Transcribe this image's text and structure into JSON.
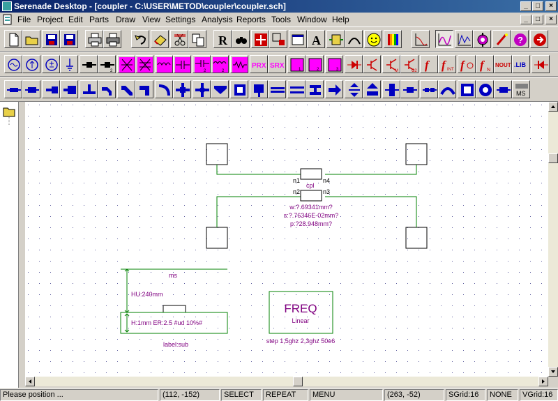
{
  "window": {
    "title": "Serenade Desktop - [coupler - C:\\USER\\METOD\\coupler\\coupler.sch]",
    "controls": [
      "_",
      "□",
      "×"
    ],
    "inner_controls": [
      "_",
      "□",
      "×"
    ]
  },
  "menu": [
    "File",
    "Project",
    "Edit",
    "Parts",
    "Draw",
    "View",
    "Settings",
    "Analysis",
    "Reports",
    "Tools",
    "Window",
    "Help"
  ],
  "toolbar1": {
    "text_buttons": {
      "resistor": "R",
      "text": "A"
    }
  },
  "toolbar2": {
    "labels": {
      "prx": "PRX",
      "srx": "SRX",
      "nout": "NOUT",
      "lib": ".LIB"
    }
  },
  "toolbar3": {
    "labels": {
      "ms": "MS"
    }
  },
  "schematic": {
    "coupler": {
      "name": "cpl",
      "ports": [
        "n1",
        "n4",
        "n2",
        "n3"
      ],
      "params": [
        "w:?.69341mm?",
        "s:?.76346E-02mm?",
        "p:?28.948mm?"
      ]
    },
    "substrate": {
      "name": "ms",
      "height_label": "HU:240mm",
      "params": "H:1mm  ER:2.5 #ud 10%#",
      "label": "label:sub"
    },
    "freq_block": {
      "title": "FREQ",
      "mode": "Linear",
      "sweep": "step 1,5ghz 2,3ghz 50e6"
    }
  },
  "status": {
    "message": "Please position ...",
    "cursor": "(112, -152)",
    "select": "SELECT",
    "repeat": "REPEAT",
    "menu": "MENU",
    "coords2": "(263, -52)",
    "sgrid": "SGrid:16",
    "snap": "NONE",
    "vgrid": "VGrid:16"
  },
  "colors": {
    "title_start": "#0a246a",
    "title_end": "#3a6ea5",
    "magenta": "#ff00ff",
    "wire": "#008000",
    "text_purple": "#800080",
    "grid_dot": "#6060a0",
    "toolbar_blue": "#0000c0"
  }
}
